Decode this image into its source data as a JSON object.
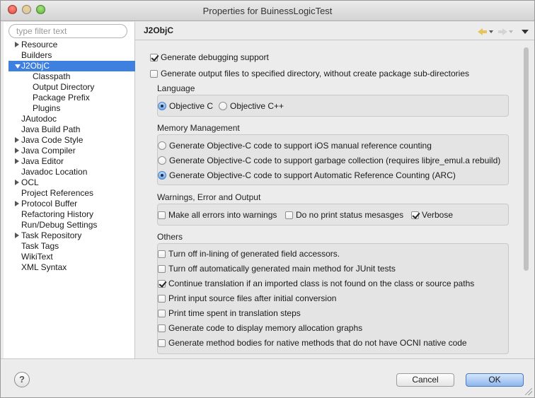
{
  "window": {
    "title": "Properties for BuinessLogicTest"
  },
  "sidebar": {
    "filter_placeholder": "type filter text",
    "items": [
      {
        "label": "Resource",
        "expand": "collapsed",
        "indent": 0
      },
      {
        "label": "Builders",
        "expand": "none",
        "indent": 0
      },
      {
        "label": "J2ObjC",
        "expand": "expanded",
        "indent": 0,
        "selected": true
      },
      {
        "label": "Classpath",
        "expand": "none",
        "indent": 1
      },
      {
        "label": "Output Directory",
        "expand": "none",
        "indent": 1
      },
      {
        "label": "Package Prefix",
        "expand": "none",
        "indent": 1
      },
      {
        "label": "Plugins",
        "expand": "none",
        "indent": 1
      },
      {
        "label": "JAutodoc",
        "expand": "none",
        "indent": 0
      },
      {
        "label": "Java Build Path",
        "expand": "none",
        "indent": 0
      },
      {
        "label": "Java Code Style",
        "expand": "collapsed",
        "indent": 0
      },
      {
        "label": "Java Compiler",
        "expand": "collapsed",
        "indent": 0
      },
      {
        "label": "Java Editor",
        "expand": "collapsed",
        "indent": 0
      },
      {
        "label": "Javadoc Location",
        "expand": "none",
        "indent": 0
      },
      {
        "label": "OCL",
        "expand": "collapsed",
        "indent": 0
      },
      {
        "label": "Project References",
        "expand": "none",
        "indent": 0
      },
      {
        "label": "Protocol Buffer",
        "expand": "collapsed",
        "indent": 0
      },
      {
        "label": "Refactoring History",
        "expand": "none",
        "indent": 0
      },
      {
        "label": "Run/Debug Settings",
        "expand": "none",
        "indent": 0
      },
      {
        "label": "Task Repository",
        "expand": "collapsed",
        "indent": 0
      },
      {
        "label": "Task Tags",
        "expand": "none",
        "indent": 0
      },
      {
        "label": "WikiText",
        "expand": "none",
        "indent": 0
      },
      {
        "label": "XML Syntax",
        "expand": "none",
        "indent": 0
      }
    ]
  },
  "page": {
    "title": "J2ObjC",
    "top_options": [
      {
        "label": "Generate debugging support",
        "checked": true
      },
      {
        "label": "Generate output files to specified directory, without create package sub-directories",
        "checked": false
      }
    ],
    "language": {
      "label": "Language",
      "options": [
        {
          "label": "Objective C",
          "selected": true
        },
        {
          "label": "Objective C++",
          "selected": false
        }
      ]
    },
    "memory": {
      "label": "Memory Management",
      "options": [
        {
          "label": "Generate Objective-C code to support iOS manual reference counting",
          "selected": false
        },
        {
          "label": "Generate Objective-C code to support garbage collection (requires libjre_emul.a rebuild)",
          "selected": false
        },
        {
          "label": "Generate Objective-C code to support Automatic Reference Counting (ARC)",
          "selected": true
        }
      ]
    },
    "warnings": {
      "label": "Warnings, Error and Output",
      "options": [
        {
          "label": "Make all errors into warnings",
          "checked": false
        },
        {
          "label": "Do no print status mesasges",
          "checked": false
        },
        {
          "label": "Verbose",
          "checked": true
        }
      ]
    },
    "others": {
      "label": "Others",
      "options": [
        {
          "label": "Turn off in-lining of generated field accessors.",
          "checked": false
        },
        {
          "label": "Turn off automatically generated main method for JUnit tests",
          "checked": false
        },
        {
          "label": "Continue translation if an imported class is not found on the class or source paths",
          "checked": true
        },
        {
          "label": "Print input source files after initial conversion",
          "checked": false
        },
        {
          "label": "Print time spent in translation steps",
          "checked": false
        },
        {
          "label": "Generate code to display memory allocation graphs",
          "checked": false
        },
        {
          "label": "Generate method bodies for native methods that do not have OCNI native code",
          "checked": false
        }
      ]
    }
  },
  "footer": {
    "help_label": "?",
    "cancel_label": "Cancel",
    "ok_label": "OK"
  },
  "colors": {
    "selection": "#3d80df",
    "default_button": "#8db6ee"
  }
}
